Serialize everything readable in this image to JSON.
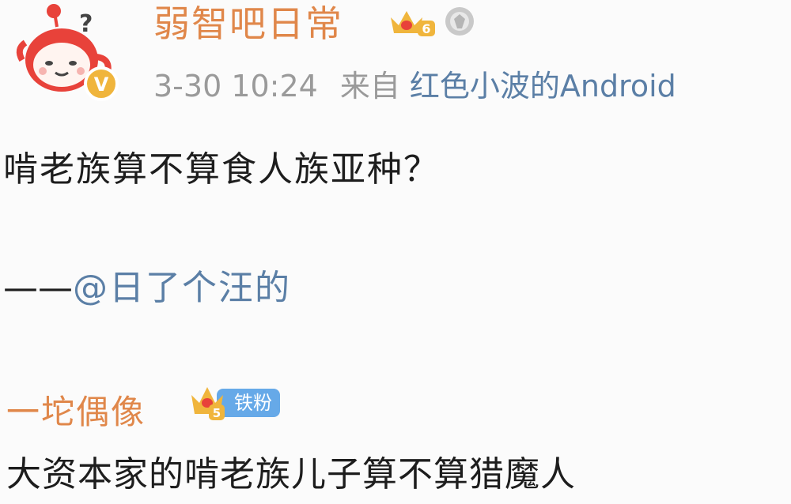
{
  "post": {
    "author": {
      "name": "弱智吧日常",
      "level_badge": "6",
      "verified_icon": "verified-v-icon",
      "avatar_icon": "red-teapot-mascot-icon",
      "medal_icon": "medal-icon"
    },
    "meta": {
      "time": "3-30 10:24",
      "source_prefix": "来自",
      "source": "红色小波的Android"
    },
    "text": "啃老族算不算食人族亚种？",
    "attribution": {
      "dash": "——",
      "mention": "@日了个汪的"
    }
  },
  "comment": {
    "author": {
      "name": "一坨偶像",
      "level_badge": "5",
      "fan_tag": "铁粉"
    },
    "text": "大资本家的啃老族儿子算不算猎魔人"
  },
  "colors": {
    "name_orange": "#e0874a",
    "link_blue": "#5b7fa6",
    "meta_gray": "#9a9a9a",
    "text_dark": "#1d1d1d",
    "fan_tag_blue": "#66a9e8",
    "avatar_red": "#e8423a",
    "badge_gold": "#f0b53c"
  }
}
